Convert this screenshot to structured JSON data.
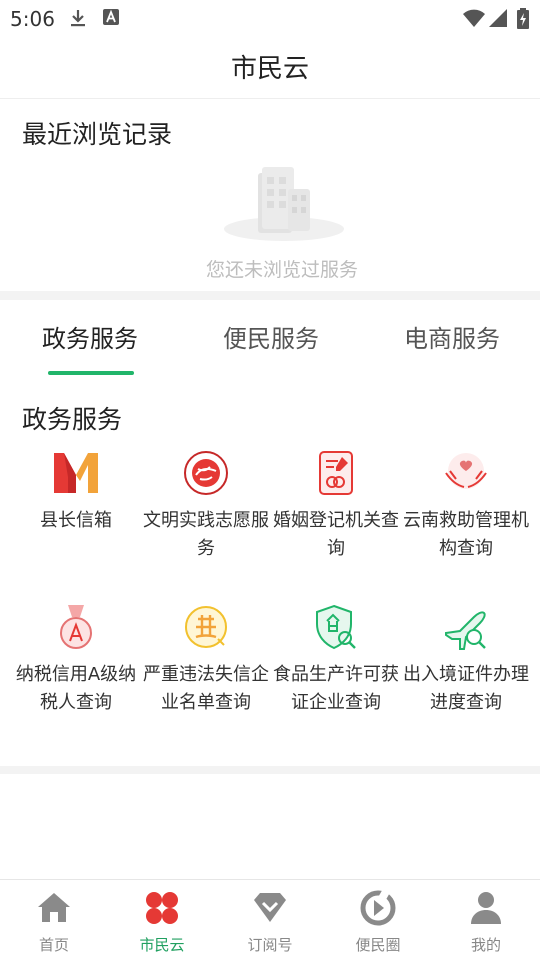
{
  "status_bar": {
    "time": "5:06"
  },
  "header": {
    "title": "市民云"
  },
  "recent": {
    "heading": "最近浏览记录",
    "empty_text": "您还未浏览过服务"
  },
  "tabs": [
    {
      "label": "政务服务",
      "active": true
    },
    {
      "label": "便民服务",
      "active": false
    },
    {
      "label": "电商服务",
      "active": false
    }
  ],
  "section": {
    "title": "政务服务",
    "services": [
      {
        "label": "县长信箱",
        "icon": "county-mayor-mailbox-icon"
      },
      {
        "label": "文明实践志愿服务",
        "icon": "volunteer-emblem-icon"
      },
      {
        "label": "婚姻登记机关查询",
        "icon": "marriage-document-icon"
      },
      {
        "label": "云南救助管理机构查询",
        "icon": "helping-hands-heart-icon"
      },
      {
        "label": "纳税信用A级纳税人查询",
        "icon": "grade-a-medal-icon"
      },
      {
        "label": "严重违法失信企业名单查询",
        "icon": "violation-badge-icon"
      },
      {
        "label": "食品生产许可获证企业查询",
        "icon": "food-shield-search-icon"
      },
      {
        "label": "出入境证件办理进度查询",
        "icon": "airplane-search-icon"
      }
    ]
  },
  "bottom_nav": [
    {
      "label": "首页",
      "icon": "home-icon",
      "active": false
    },
    {
      "label": "市民云",
      "icon": "clover-icon",
      "active": true
    },
    {
      "label": "订阅号",
      "icon": "diamond-check-icon",
      "active": false
    },
    {
      "label": "便民圈",
      "icon": "ring-play-icon",
      "active": false
    },
    {
      "label": "我的",
      "icon": "person-icon",
      "active": false
    }
  ],
  "colors": {
    "accent": "#21b56a",
    "active_nav": "#e53935",
    "empty_text": "#bdbdbd"
  }
}
